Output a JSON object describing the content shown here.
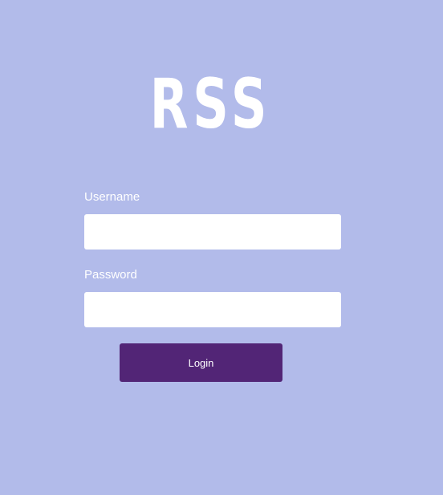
{
  "logo": {
    "text": "RSS"
  },
  "form": {
    "username_label": "Username",
    "username_value": "",
    "password_label": "Password",
    "password_value": "",
    "login_label": "Login"
  },
  "colors": {
    "background": "#b2bbea",
    "button": "#522576",
    "input": "#ffffff",
    "text": "#ffffff"
  }
}
